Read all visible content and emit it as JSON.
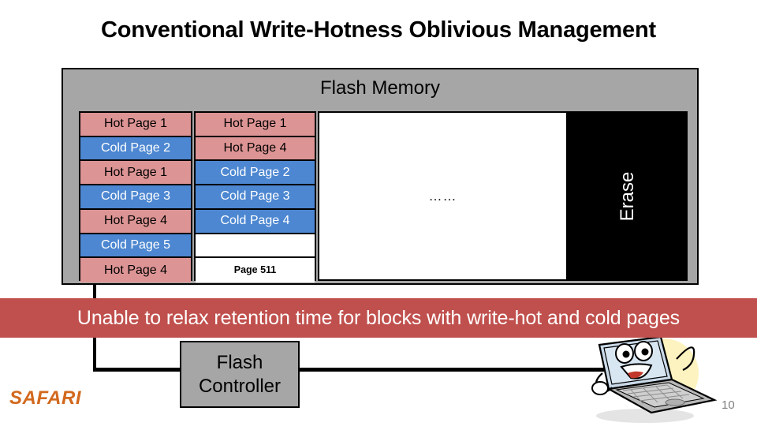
{
  "slide": {
    "title": "Conventional Write-Hotness Oblivious Management",
    "number": "10",
    "logo": "SAFARI"
  },
  "flash_memory": {
    "title": "Flash Memory",
    "ellipsis": "……",
    "erase_label": "Erase",
    "columns": [
      {
        "name": "block-column-1",
        "cells": [
          {
            "text": "Hot Page 1",
            "kind": "hot"
          },
          {
            "text": "Cold Page 2",
            "kind": "cold"
          },
          {
            "text": "Hot Page 1",
            "kind": "hot"
          },
          {
            "text": "Cold Page 3",
            "kind": "cold"
          },
          {
            "text": "Hot Page 4",
            "kind": "hot"
          },
          {
            "text": "Cold Page 5",
            "kind": "cold"
          },
          {
            "text": "Hot Page 4",
            "kind": "hot"
          }
        ]
      },
      {
        "name": "block-column-2",
        "cells": [
          {
            "text": "Hot Page 1",
            "kind": "hot"
          },
          {
            "text": "Hot Page 4",
            "kind": "hot"
          },
          {
            "text": "Cold Page 2",
            "kind": "cold"
          },
          {
            "text": "Cold Page 3",
            "kind": "cold"
          },
          {
            "text": "Cold Page 4",
            "kind": "cold"
          },
          {
            "text": "",
            "kind": "empty"
          },
          {
            "text": "Page 511",
            "kind": "label"
          }
        ]
      }
    ]
  },
  "controller": {
    "line1": "Flash",
    "line2": "Controller"
  },
  "takeaway": {
    "text": "Unable to relax retention time for blocks with write-hot and cold pages"
  },
  "colors": {
    "hot_page": "#dd9494",
    "cold_page": "#4d87d1",
    "flash_memory_bg": "#a6a6a6",
    "erase_bg": "#000000",
    "banner": "#c0504d",
    "logo": "#d2691e"
  }
}
